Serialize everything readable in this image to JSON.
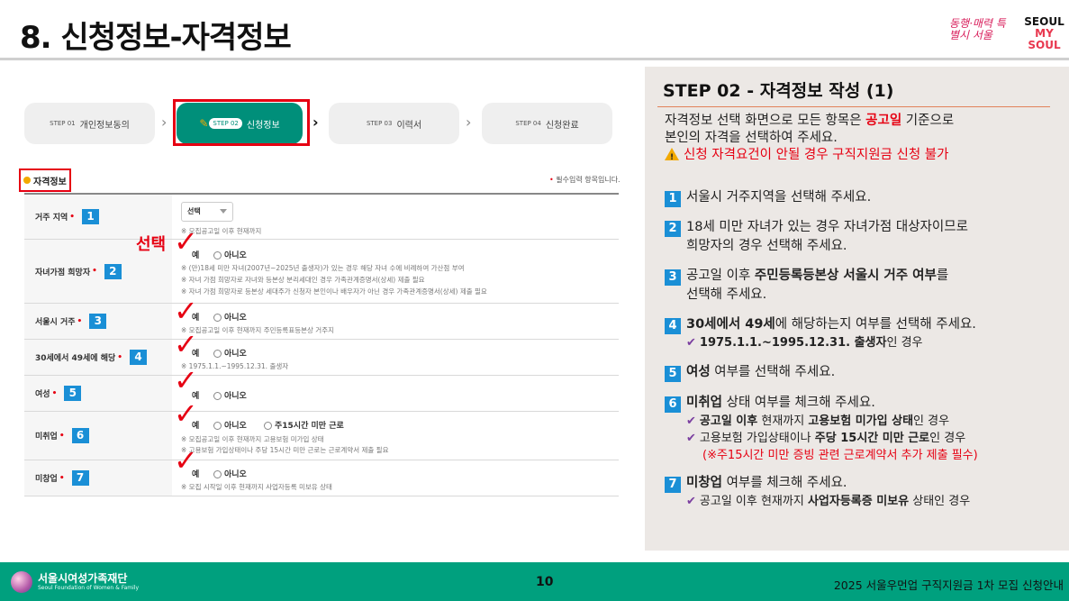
{
  "header": {
    "title": "8. 신청정보-자격정보",
    "logo_a": "동행·매력 특별시 서울",
    "logo_b_line1": "SEOUL",
    "logo_b_line2": "MY SOUL"
  },
  "steps": [
    {
      "num": "STEP 01",
      "label": "개인정보동의"
    },
    {
      "num": "STEP 02",
      "label": "신청정보"
    },
    {
      "num": "STEP 03",
      "label": "이력서"
    },
    {
      "num": "STEP 04",
      "label": "신청완료"
    }
  ],
  "section": {
    "label": "자격정보",
    "required_note": "필수입력 항목입니다."
  },
  "annot_select": "선택",
  "form": {
    "rows": [
      {
        "label": "거주 지역",
        "badge": "1",
        "select": "선택",
        "notes": [
          "※ 모집공고일 이후 현재까지"
        ]
      },
      {
        "label": "자녀가점 희망자",
        "badge": "2",
        "opt_yes": "예",
        "opt_no": "아니오",
        "notes": [
          "※ (만)18세 미만 자녀(2007년~2025년 출생자)가 있는 경우 해당 자녀 수에 비례하여 가산점 부여",
          "※ 자녀 가점 희망자로 자녀와 등본상 분리세대인 경우 가족관계증명서(상세) 제출 필요",
          "※ 자녀 가점 희망자로 등본상 세대주가 신청자 본인이나 배우자가 아닌 경우 가족관계증명서(상세) 제출 필요"
        ]
      },
      {
        "label": "서울시 거주",
        "badge": "3",
        "opt_yes": "예",
        "opt_no": "아니오",
        "notes": [
          "※ 모집공고일 이후 현재까지 주민등록표등본상 거주지"
        ]
      },
      {
        "label": "30세에서 49세에 해당",
        "badge": "4",
        "opt_yes": "예",
        "opt_no": "아니오",
        "notes": [
          "※ 1975.1.1.~1995.12.31. 출생자"
        ]
      },
      {
        "label": "여성",
        "badge": "5",
        "opt_yes": "예",
        "opt_no": "아니오",
        "notes": []
      },
      {
        "label": "미취업",
        "badge": "6",
        "opt_yes": "예",
        "opt_no": "아니오",
        "opt_extra": "주15시간 미만 근로",
        "notes": [
          "※ 모집공고일 이후 현재까지 고용보험 미가입 상태",
          "※ 고용보험 가입상태이나 주당 15시간 미만 근로는 근로계약서 제출 필요"
        ]
      },
      {
        "label": "미창업",
        "badge": "7",
        "opt_yes": "예",
        "opt_no": "아니오",
        "notes": [
          "※ 모집 시작일 이후 현재까지 사업자등록 미보유 상태"
        ]
      }
    ]
  },
  "panel": {
    "title": "STEP 02 - 자격정보 작성 (1)",
    "intro_1a": "자격정보 선택 화면으로 모든 항목은 ",
    "intro_1b": "공고일",
    "intro_1c": " 기준으로",
    "intro_2": "본인의 자격을 선택하여 주세요.",
    "warning": "신청 자격요건이 안될 경우 구직지원금 신청 불가",
    "items": [
      {
        "n": "1",
        "text": "서울시 거주지역을 선택해 주세요."
      },
      {
        "n": "2",
        "text": "18세 미만 자녀가 있는 경우 자녀가점 대상자이므로",
        "text2": "희망자의 경우 선택해 주세요."
      },
      {
        "n": "3",
        "pre": "공고일 이후 ",
        "bold": "주민등록등본상 서울시 거주 여부",
        "post": "를",
        "text2": "선택해 주세요."
      },
      {
        "n": "4",
        "bold": "30세에서 49세",
        "post": "에 해당하는지 여부를 선택해 주세요.",
        "sub": "1975.1.1.~1995.12.31. 출생자",
        "sub_post": "인 경우"
      },
      {
        "n": "5",
        "bold": "여성",
        "post": " 여부를 선택해 주세요."
      },
      {
        "n": "6",
        "bold": "미취업",
        "post": " 상태 여부를 체크해 주세요.",
        "sub1_bold": "공고일 이후",
        "sub1_mid": " 현재까지 ",
        "sub1_bold2": "고용보험 미가입 상태",
        "sub1_post": "인 경우",
        "sub2_pre": "고용보험 가입상태이나 ",
        "sub2_bold": "주당 15시간 미만 근로",
        "sub2_post": "인 경우",
        "sub3": "(※주15시간 미만 증빙 관련 근로계약서 추가 제출 필수)"
      },
      {
        "n": "7",
        "bold": "미창업",
        "post": " 여부를 체크해 주세요.",
        "sub_pre": "공고일 이후 현재까지 ",
        "sub_bold": "사업자등록증 미보유",
        "sub_post": " 상태인 경우"
      }
    ]
  },
  "footer": {
    "org": "서울시여성가족재단",
    "org_en": "Seoul Foundation of Women & Family",
    "page": "10",
    "right": "2025 서울우먼업 구직지원금 1차 모집 신청안내"
  },
  "colors": {
    "accent": "#008f7a",
    "red": "#e60012",
    "badge": "#1a8fd6",
    "footer": "#00a07e",
    "panel": "#ece8e5"
  }
}
